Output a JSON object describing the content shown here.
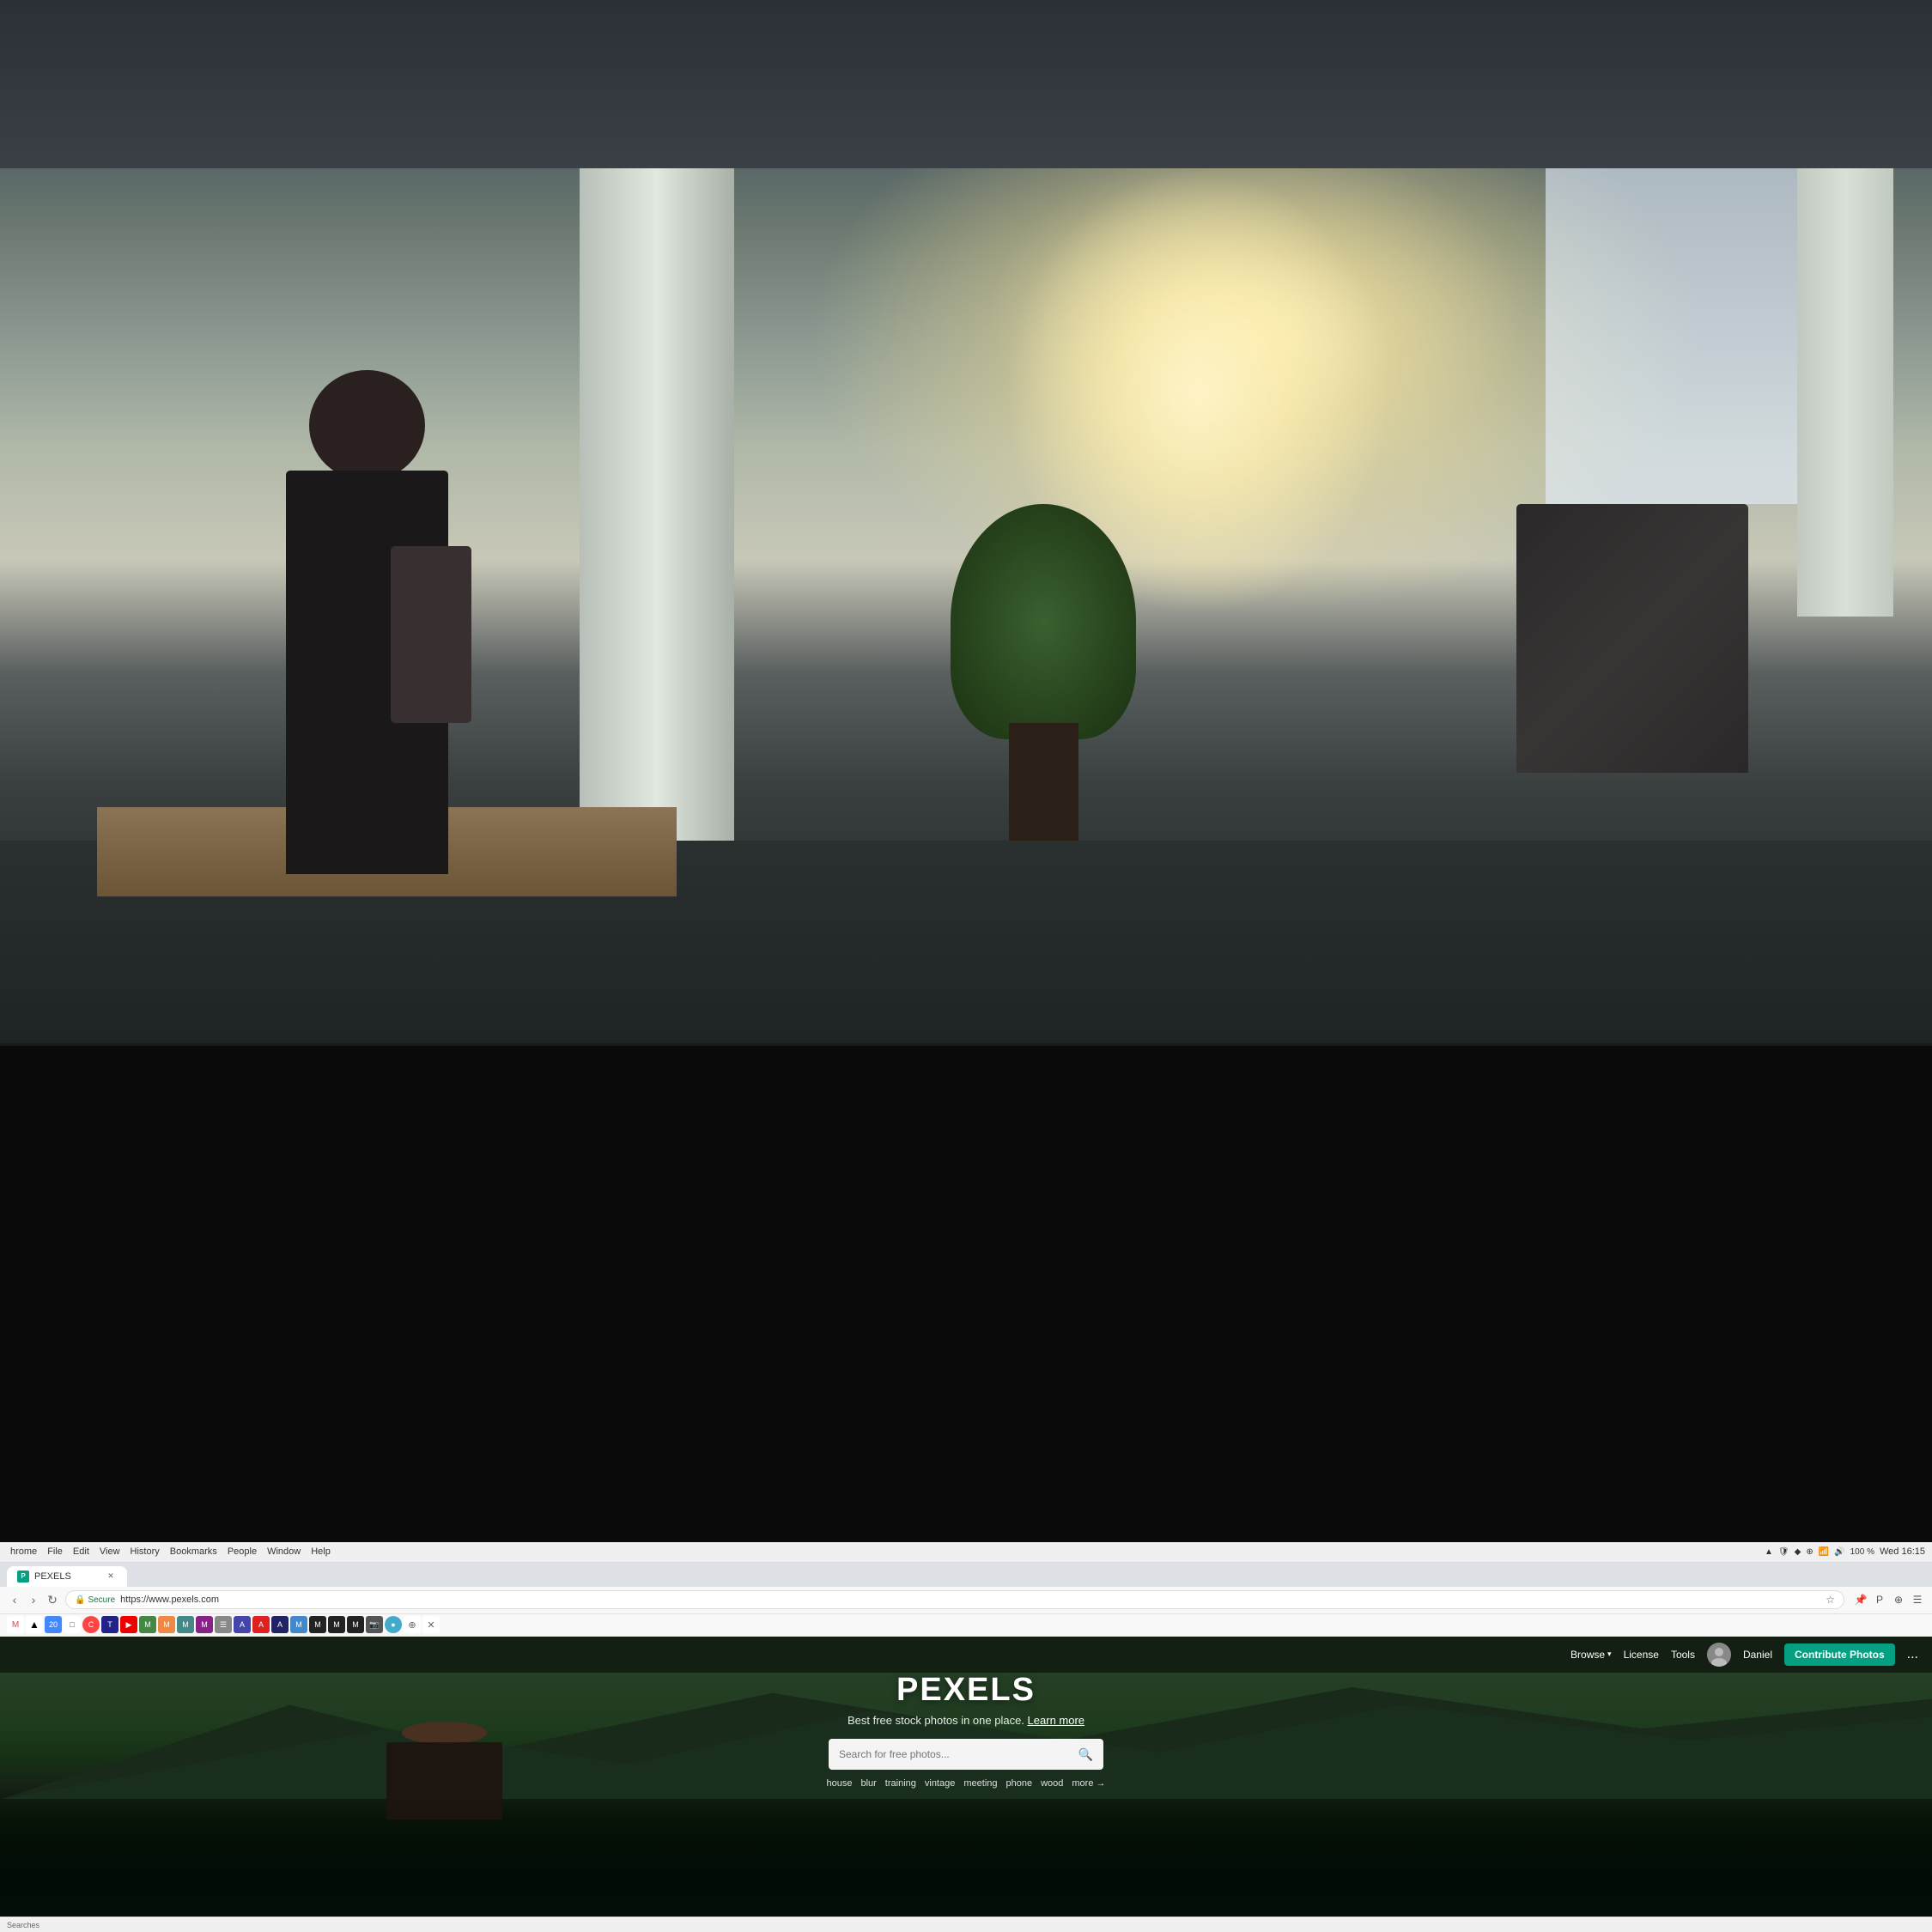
{
  "background": {
    "alt": "Office workspace with blurred background"
  },
  "chrome": {
    "menu_items": [
      "hrome",
      "File",
      "Edit",
      "View",
      "History",
      "Bookmarks",
      "People",
      "Window",
      "Help"
    ],
    "time": "Wed 16:15",
    "battery": "100 %",
    "zoom": "100 %",
    "url": "https://www.pexels.com",
    "secure_label": "Secure",
    "tab_title": "Pexels"
  },
  "pexels": {
    "nav": {
      "browse_label": "Browse",
      "license_label": "License",
      "tools_label": "Tools",
      "username": "Daniel",
      "contribute_label": "Contribute Photos",
      "more_label": "..."
    },
    "hero": {
      "logo": "PEXELS",
      "tagline": "Best free stock photos in one place.",
      "learn_more": "Learn more",
      "search_placeholder": "Search for free photos...",
      "tags": [
        "house",
        "blur",
        "training",
        "vintage",
        "meeting",
        "phone",
        "wood"
      ],
      "more_tag": "more →"
    }
  },
  "bookmarks": [
    {
      "icon": "M",
      "class": "bm-gmail"
    },
    {
      "icon": "◉",
      "class": "bm-maps"
    },
    {
      "icon": "📅",
      "class": "bm-cal1"
    },
    {
      "icon": "20",
      "class": "bm-cal2"
    },
    {
      "icon": "C",
      "class": "bm-circle"
    },
    {
      "icon": "T",
      "class": "bm-blue"
    },
    {
      "icon": "▶",
      "class": "bm-red"
    },
    {
      "icon": "≡",
      "class": "bm-purple"
    },
    {
      "icon": "M",
      "class": "bm-green"
    },
    {
      "icon": "M",
      "class": "bm-orange"
    },
    {
      "icon": "M",
      "class": "bm-teal"
    }
  ],
  "bottom_bar": {
    "label": "Searches"
  }
}
